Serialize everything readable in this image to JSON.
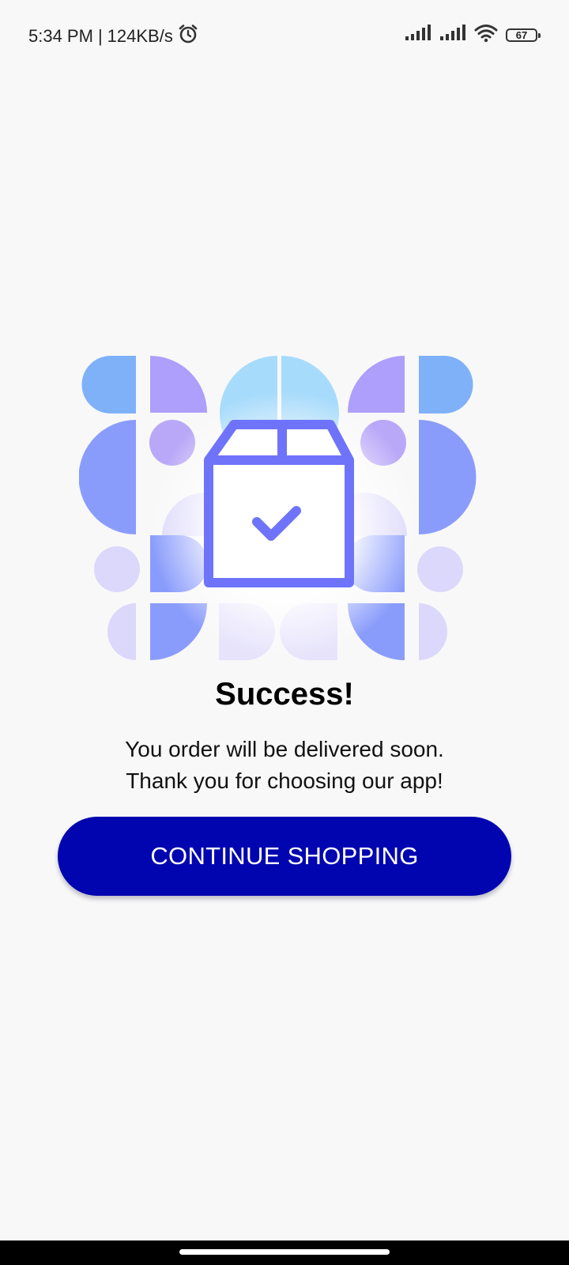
{
  "status_bar": {
    "time": "5:34 PM",
    "separator": "|",
    "network_speed": "124KB/s",
    "alarm_icon": "alarm-clock-icon",
    "battery_level": "67",
    "icons": [
      "signal-icon",
      "signal-icon",
      "wifi-icon",
      "battery-icon"
    ]
  },
  "illustration": {
    "icon": "package-check-icon",
    "colors": {
      "blue": "#7fb1f8",
      "purple": "#ad9ffb",
      "sky": "#a7dbfb",
      "indigo": "#8790fb",
      "lavender": "#dcd8fb",
      "outline": "#6f73fa"
    }
  },
  "content": {
    "title": "Success!",
    "message_line_1": "You order will be delivered soon.",
    "message_line_2": "Thank you for choosing our app!"
  },
  "actions": {
    "continue_label": "CONTINUE SHOPPING"
  },
  "theme": {
    "primary": "#0005b0",
    "background": "#f8f8f9"
  }
}
